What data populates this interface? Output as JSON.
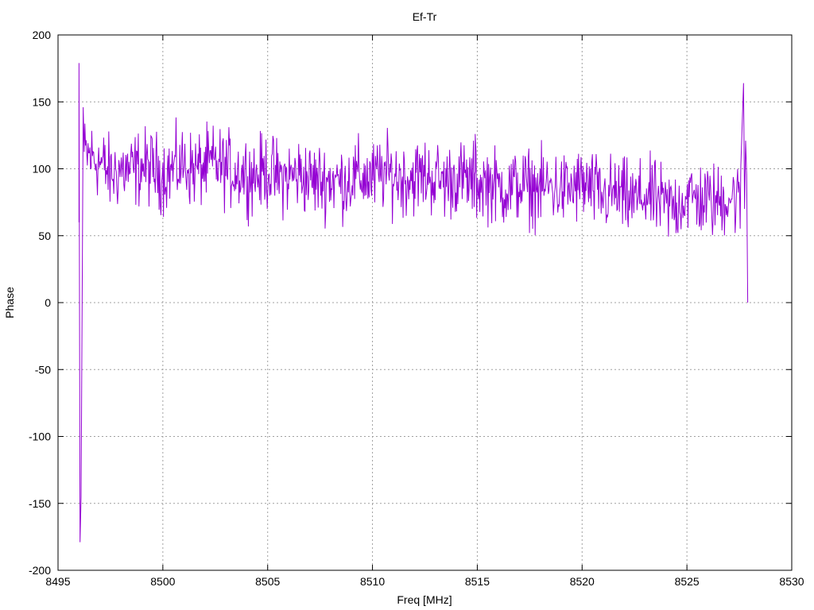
{
  "chart_data": {
    "type": "line",
    "title": "Ef-Tr",
    "xlabel": "Freq [MHz]",
    "ylabel": "Phase",
    "xlim": [
      8495,
      8530
    ],
    "ylim": [
      -200,
      200
    ],
    "x_ticks": [
      8495,
      8500,
      8505,
      8510,
      8515,
      8520,
      8525,
      8530
    ],
    "y_ticks": [
      -200,
      -150,
      -100,
      -50,
      0,
      50,
      100,
      150,
      200
    ],
    "grid": true,
    "legend": "none",
    "series": [
      {
        "color": "#9400d3",
        "x_start": 8496.0,
        "x_step": 0.5,
        "x_end": 8527.8,
        "y_approx": [
          -150,
          110,
          105,
          95,
          100,
          98,
          102,
          100,
          96,
          100,
          103,
          99,
          101,
          104,
          100,
          98,
          97,
          95,
          99,
          93,
          94,
          96,
          92,
          91,
          92,
          90,
          93,
          94,
          92,
          97,
          95,
          93,
          94,
          95,
          93,
          90,
          94,
          91,
          89,
          90,
          86,
          85,
          88,
          86,
          85,
          87,
          84,
          85,
          88,
          84,
          79,
          82,
          78,
          76,
          80,
          77,
          72,
          73,
          80,
          77,
          76,
          75,
          80,
          77,
          70
        ]
      }
    ],
    "spikes": [
      {
        "x": 8496.0,
        "y": 179
      },
      {
        "x": 8496.05,
        "y": -179
      },
      {
        "x": 8496.1,
        "y": -145
      },
      {
        "x": 8496.2,
        "y": 146
      },
      {
        "x": 8514.9,
        "y": 126
      },
      {
        "x": 8527.7,
        "y": 164
      },
      {
        "x": 8527.8,
        "y": 121
      },
      {
        "x": 8527.9,
        "y": 0
      }
    ]
  }
}
